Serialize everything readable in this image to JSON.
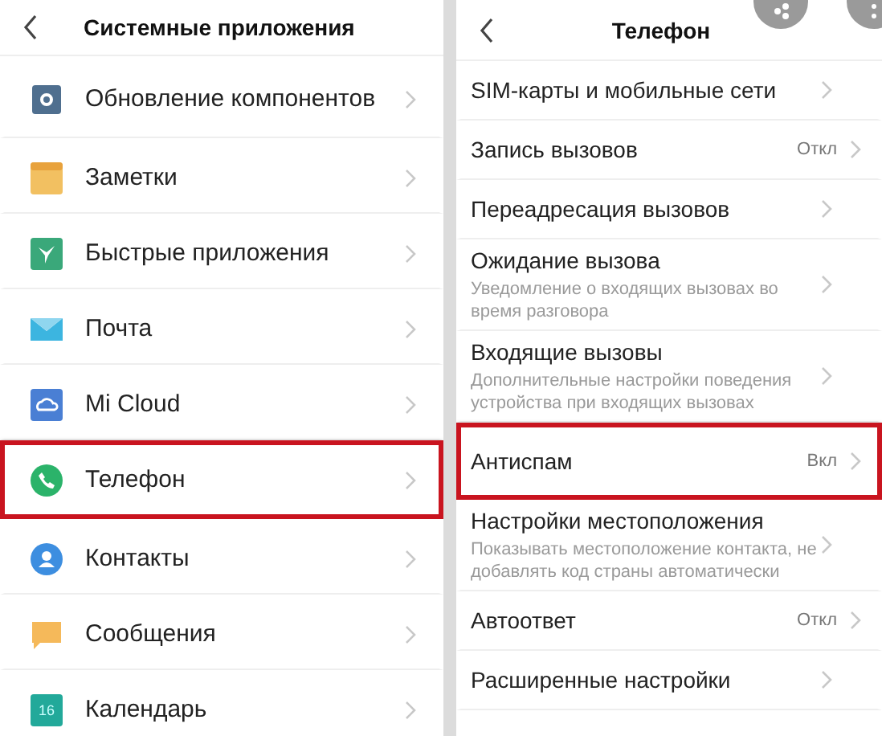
{
  "left": {
    "title": "Системные приложения",
    "items": [
      {
        "label": "Обновление компонентов",
        "kind": "gear",
        "color": "#4f6f8f",
        "highlighted": false
      },
      {
        "label": "Заметки",
        "kind": "notes",
        "color": "#f2c061",
        "highlighted": false
      },
      {
        "label": "Быстрые приложения",
        "kind": "bird",
        "color": "#3aa87a",
        "highlighted": false
      },
      {
        "label": "Почта",
        "kind": "mail",
        "color": "#3cb5e0",
        "highlighted": false
      },
      {
        "label": "Mi Cloud",
        "kind": "cloud",
        "color": "#4a7fd4",
        "highlighted": false
      },
      {
        "label": "Телефон",
        "kind": "phone",
        "color": "#2bb36a",
        "highlighted": true
      },
      {
        "label": "Контакты",
        "kind": "person",
        "color": "#3d8ee0",
        "highlighted": false
      },
      {
        "label": "Сообщения",
        "kind": "bubble",
        "color": "#f5b95a",
        "highlighted": false
      },
      {
        "label": "Календарь",
        "kind": "calendar",
        "color": "#22a99a",
        "badge": "16",
        "highlighted": false
      }
    ]
  },
  "right": {
    "title": "Телефон",
    "items": [
      {
        "label": "SIM-карты и мобильные сети",
        "highlighted": false
      },
      {
        "label": "Запись вызовов",
        "value": "Откл",
        "highlighted": false
      },
      {
        "label": "Переадресация вызовов",
        "highlighted": false
      },
      {
        "label": "Ожидание вызова",
        "subtitle": "Уведомление о входящих вызовах во время разговора",
        "highlighted": false
      },
      {
        "label": "Входящие вызовы",
        "subtitle": "Дополнительные настройки поведения устройства при входящих вызовах",
        "highlighted": false
      },
      {
        "label": "Антиспам",
        "value": "Вкл",
        "highlighted": true
      },
      {
        "label": "Настройки местоположения",
        "subtitle": "Показывать местоположение контакта, не добавлять код страны автоматически",
        "highlighted": false
      },
      {
        "label": "Автоответ",
        "value": "Откл",
        "highlighted": false
      },
      {
        "label": "Расширенные настройки",
        "highlighted": false
      }
    ]
  }
}
